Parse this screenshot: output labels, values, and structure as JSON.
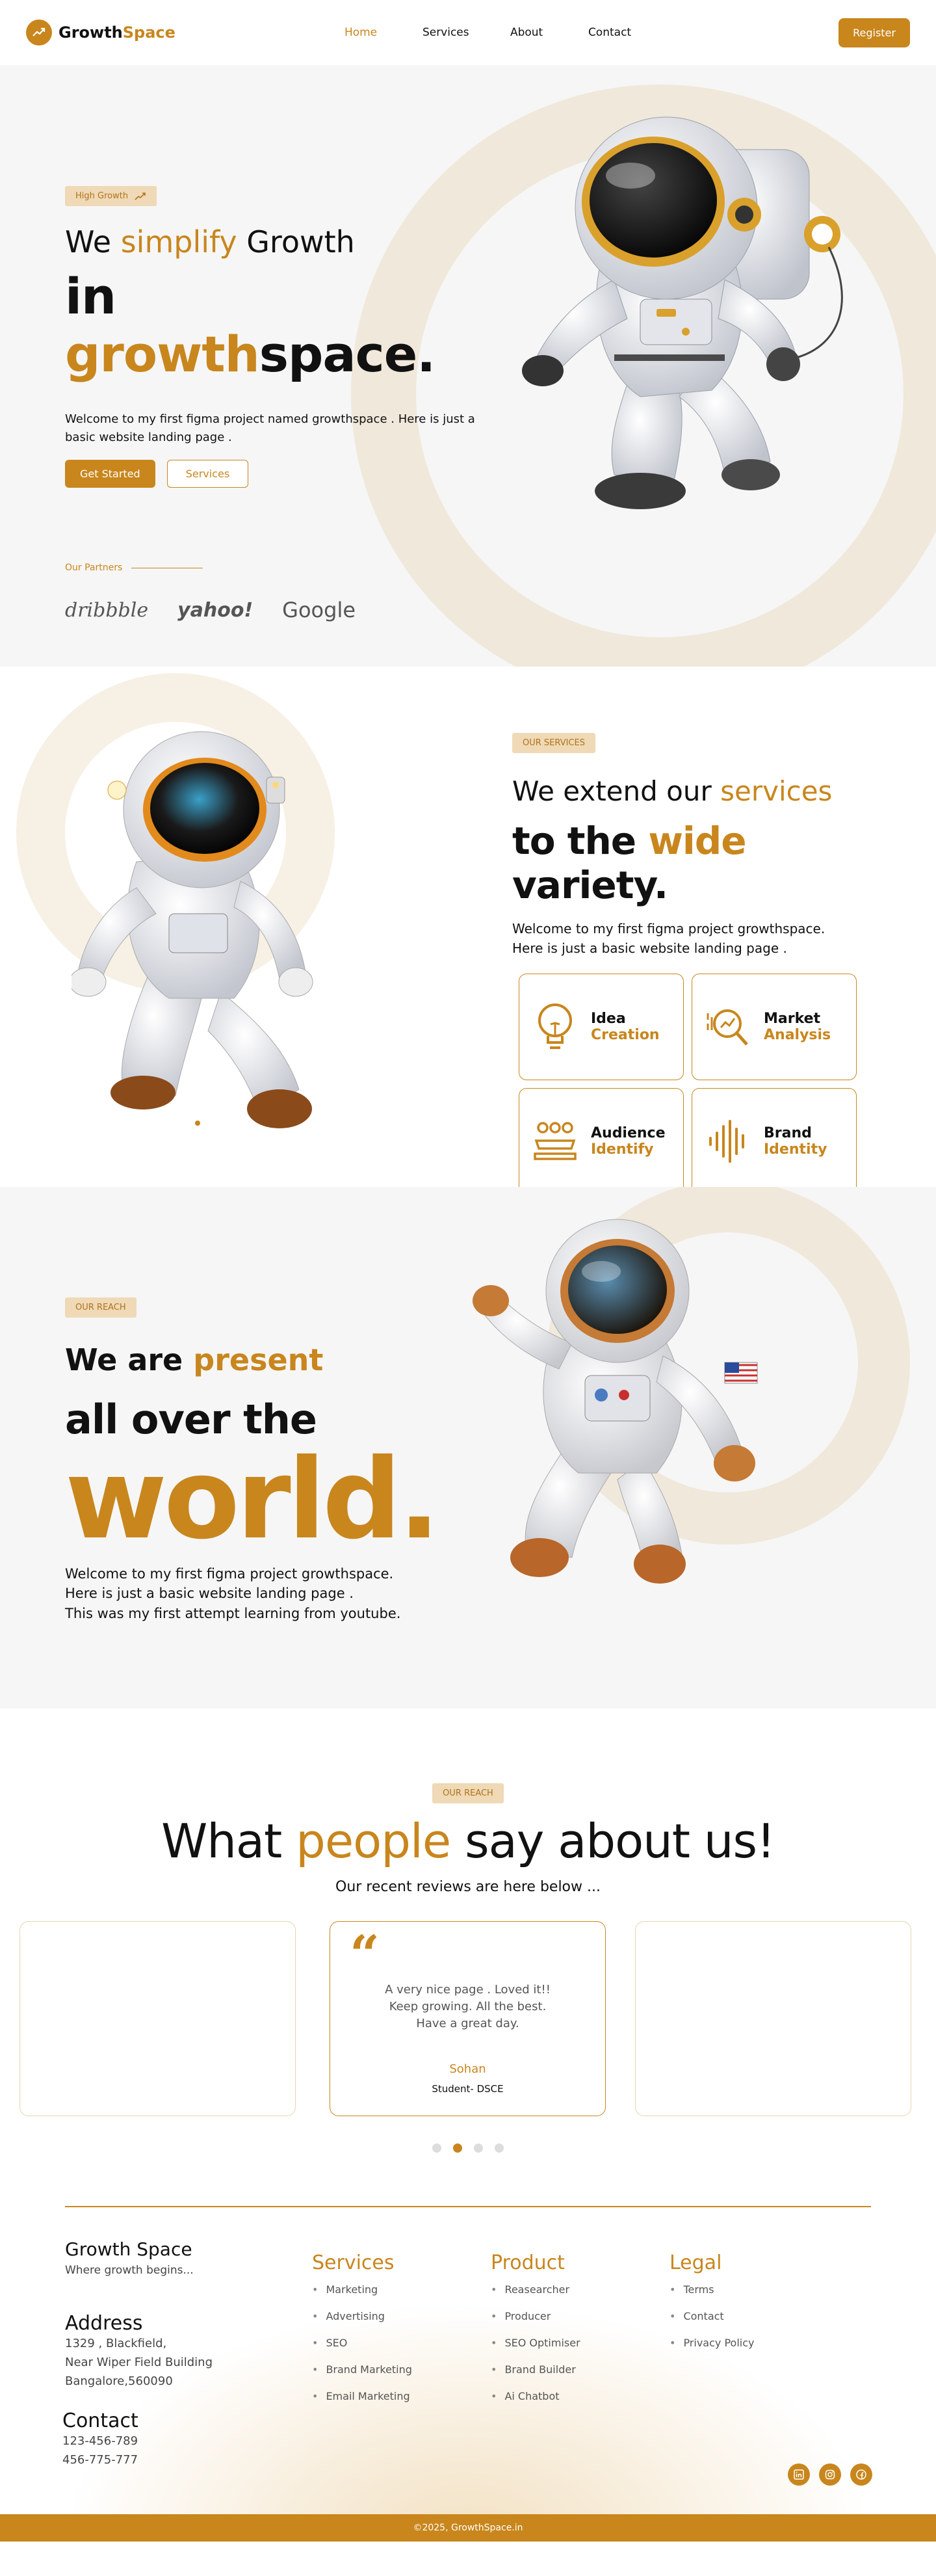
{
  "nav": {
    "brand_part1": "Growth",
    "brand_part2": "Space",
    "links": [
      "Home",
      "Services",
      "About",
      "Contact"
    ],
    "register": "Register"
  },
  "hero": {
    "badge": "High Growth",
    "line1_a": "We ",
    "line1_b": "simplify",
    "line1_c": " Growth",
    "line2_a": "in ",
    "line2_b": "growth",
    "line2_c": "space.",
    "desc": "Welcome to my first figma project named growthspace . Here is just a basic website landing page .",
    "btn_primary": "Get Started",
    "btn_secondary": "Services",
    "partners_label": "Our Partners",
    "partners": [
      "dribbble",
      "yahoo!",
      "Google"
    ]
  },
  "services": {
    "badge": "OUR SERVICES",
    "line1_a": "We extend our ",
    "line1_b": "services",
    "line2_a": "to the ",
    "line2_b": "wide",
    "line2_c": " variety.",
    "desc": "Welcome to my first figma project growthspace. Here is just a basic website landing page .",
    "cards": [
      {
        "t1": "Idea",
        "t2": "Creation",
        "icon": "lightbulb-icon"
      },
      {
        "t1": "Market",
        "t2": "Analysis",
        "icon": "magnifier-chart-icon"
      },
      {
        "t1": "Audience",
        "t2": "Identify",
        "icon": "audience-icon"
      },
      {
        "t1": "Brand",
        "t2": "Identity",
        "icon": "soundwave-icon"
      }
    ]
  },
  "reach": {
    "badge": "OUR REACH",
    "line1_a": "We are ",
    "line1_b": "present",
    "line2": "all over the",
    "line3": "world.",
    "desc1": "Welcome to my first figma project growthspace.",
    "desc2": "Here is just a basic website landing page .",
    "desc3": "This was my first attempt learning from youtube."
  },
  "testimonials": {
    "badge": "OUR REACH",
    "h_a": "What ",
    "h_b": "people",
    "h_c": " say about us!",
    "sub": "Our recent reviews are here below ...",
    "review_text": "A very nice page . Loved it!!\nKeep growing. All the best.\nHave  a great day.",
    "review_name": "Sohan",
    "review_role": "Student- DSCE",
    "dots": 4,
    "active_dot": 1
  },
  "footer": {
    "brand": "Growth Space",
    "tagline": "Where growth begins...",
    "address_title": "Address",
    "address_lines": [
      "1329 , Blackfield,",
      "Near Wiper Field Building",
      "Bangalore,560090"
    ],
    "contact_title": "Contact",
    "phones": [
      "123-456-789",
      "456-775-777"
    ],
    "columns": [
      {
        "title": "Services",
        "items": [
          "Marketing",
          "Advertising",
          "SEO",
          "Brand Marketing",
          "Email Marketing"
        ]
      },
      {
        "title": "Product",
        "items": [
          "Reasearcher",
          "Producer",
          "SEO Optimiser",
          "Brand Builder",
          "Ai Chatbot"
        ]
      },
      {
        "title": "Legal",
        "items": [
          "Terms",
          "Contact",
          "Privacy Policy"
        ]
      }
    ],
    "socials": [
      "linkedin-icon",
      "instagram-icon",
      "facebook-icon"
    ],
    "copyright": "©2025, GrowthSpace.in"
  },
  "colors": {
    "accent": "#c8861d",
    "accent_light": "#efd9b6",
    "bg_gray": "#f6f6f6"
  }
}
